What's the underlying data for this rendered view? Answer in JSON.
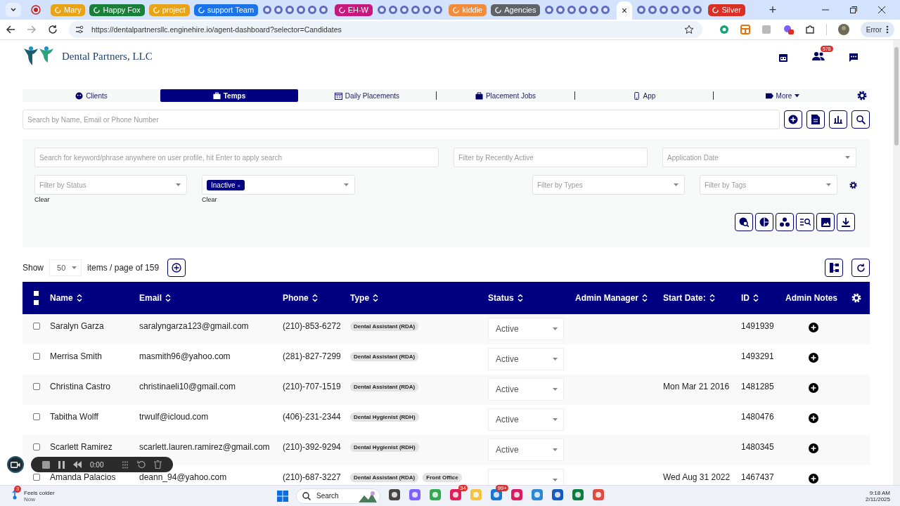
{
  "browser": {
    "tabs": [
      {
        "kind": "recording"
      },
      {
        "kind": "group",
        "label": "Mary",
        "color": "#e8a317"
      },
      {
        "kind": "group",
        "label": "Happy Fox",
        "color": "#188038"
      },
      {
        "kind": "group",
        "label": "project",
        "color": "#e8a317"
      },
      {
        "kind": "group",
        "label": "support Team",
        "color": "#1a73e8"
      },
      {
        "kind": "favicons"
      },
      {
        "kind": "group",
        "label": "EH-W",
        "color": "#c5197d"
      },
      {
        "kind": "favicons"
      },
      {
        "kind": "group",
        "label": "kiddie",
        "color": "#f28b3a"
      },
      {
        "kind": "group",
        "label": "Agencies",
        "color": "#5f6368"
      },
      {
        "kind": "favicons"
      },
      {
        "kind": "active",
        "close": "×"
      },
      {
        "kind": "favicons"
      },
      {
        "kind": "group",
        "label": "Silver",
        "color": "#d93025"
      }
    ],
    "new_tab": "+",
    "url": "https://dentalpartnersllc.enginehire.io/agent-dashboard?selector=Candidates",
    "profile_status": "Error"
  },
  "header": {
    "company": "Dental Partners, LLC",
    "people_badge": "578"
  },
  "nav": [
    {
      "label": "Clients",
      "selected": false
    },
    {
      "label": "Temps",
      "selected": true
    },
    {
      "label": "Daily Placements",
      "selected": false
    },
    {
      "label": "Placement Jobs",
      "selected": false
    },
    {
      "label": "App",
      "selected": false
    },
    {
      "label": "More",
      "selected": false
    }
  ],
  "search": {
    "placeholder": "Search by Name, Email or Phone Number"
  },
  "filters": {
    "keyword": {
      "placeholder": "Search for keyword/phrase anywhere on user profile, hit Enter to apply search"
    },
    "recently_active": {
      "placeholder": "Filter by Recently Active"
    },
    "application_date": {
      "placeholder": "Application Date"
    },
    "status": {
      "placeholder": "Filter by Status",
      "clear": "Clear"
    },
    "status_values": {
      "chips": [
        {
          "label": "Inactive",
          "remove": "×"
        }
      ],
      "clear": "Clear"
    },
    "types": {
      "placeholder": "Filter by Types"
    },
    "tags": {
      "placeholder": "Filter by Tags"
    }
  },
  "pagination": {
    "show": "Show",
    "page_size": "50",
    "label": "items / page of 159"
  },
  "table": {
    "select_all": {
      "checked": false
    },
    "columns": [
      {
        "label": "Name",
        "sortable": true
      },
      {
        "label": "Email",
        "sortable": true
      },
      {
        "label": "Phone",
        "sortable": true
      },
      {
        "label": "Type",
        "sortable": true
      },
      {
        "label": "Status",
        "sortable": true
      },
      {
        "label": "Admin Manager",
        "sortable": true
      },
      {
        "label": "Start Date:",
        "sortable": true
      },
      {
        "label": "ID",
        "sortable": true
      },
      {
        "label": "Admin Notes",
        "sortable": false
      }
    ],
    "rows": [
      {
        "checked": false,
        "name": "Saralyn Garza",
        "email": "saralyngarza123@gmail.com",
        "phone": "(210)-853-6272",
        "types": [
          "Dental Assistant (RDA)"
        ],
        "status": "Active",
        "id": "1491939"
      },
      {
        "checked": false,
        "name": "Merrisa Smith",
        "email": "masmith96@yahoo.com",
        "phone": "(281)-827-7299",
        "types": [
          "Dental Assistant (RDA)"
        ],
        "status": "Active",
        "id": "1493291"
      },
      {
        "checked": false,
        "name": "Christina Castro",
        "email": "christinaeli10@gmail.com",
        "phone": "(210)-707-1519",
        "types": [
          "Dental Assistant (RDA)"
        ],
        "status": "Active",
        "start_date": "Mon Mar 21 2016",
        "id": "1481285"
      },
      {
        "checked": false,
        "name": "Tabitha Wolff",
        "email": "trwulf@icloud.com",
        "phone": "(406)-231-2344",
        "types": [
          "Dental Hygienist (RDH)"
        ],
        "status": "Active",
        "id": "1480476"
      },
      {
        "checked": false,
        "name": "Scarlett Ramirez",
        "email": "scarlett.lauren.ramirez@gmail.com",
        "phone": "(210)-392-9294",
        "types": [
          "Dental Hygienist (RDH)"
        ],
        "status": "Active",
        "id": "1480345"
      },
      {
        "checked": false,
        "name": "Amanda Palacios",
        "email": "deann_94@yahoo.com",
        "phone": "(210)-687-3227",
        "types": [
          "Dental Assistant (RDA)",
          "Front Office"
        ],
        "start_date": "Wed Aug 31 2022",
        "id": "1467437"
      }
    ]
  },
  "recorder": {
    "time": "0:00"
  },
  "taskbar": {
    "weather": {
      "badge": "3",
      "title": "Feels colder",
      "subtitle": "Now"
    },
    "search": "Search",
    "apps": [
      {
        "kind": "files"
      },
      {
        "kind": "copilot"
      },
      {
        "kind": "chrome"
      },
      {
        "kind": "slack",
        "badge": "34"
      },
      {
        "kind": "folder"
      },
      {
        "kind": "mail",
        "badge": "99+"
      },
      {
        "kind": "chat"
      },
      {
        "kind": "photos"
      },
      {
        "kind": "word"
      },
      {
        "kind": "excel"
      },
      {
        "kind": "snip"
      }
    ],
    "time": "9:18 AM",
    "date": "2/11/2025"
  }
}
